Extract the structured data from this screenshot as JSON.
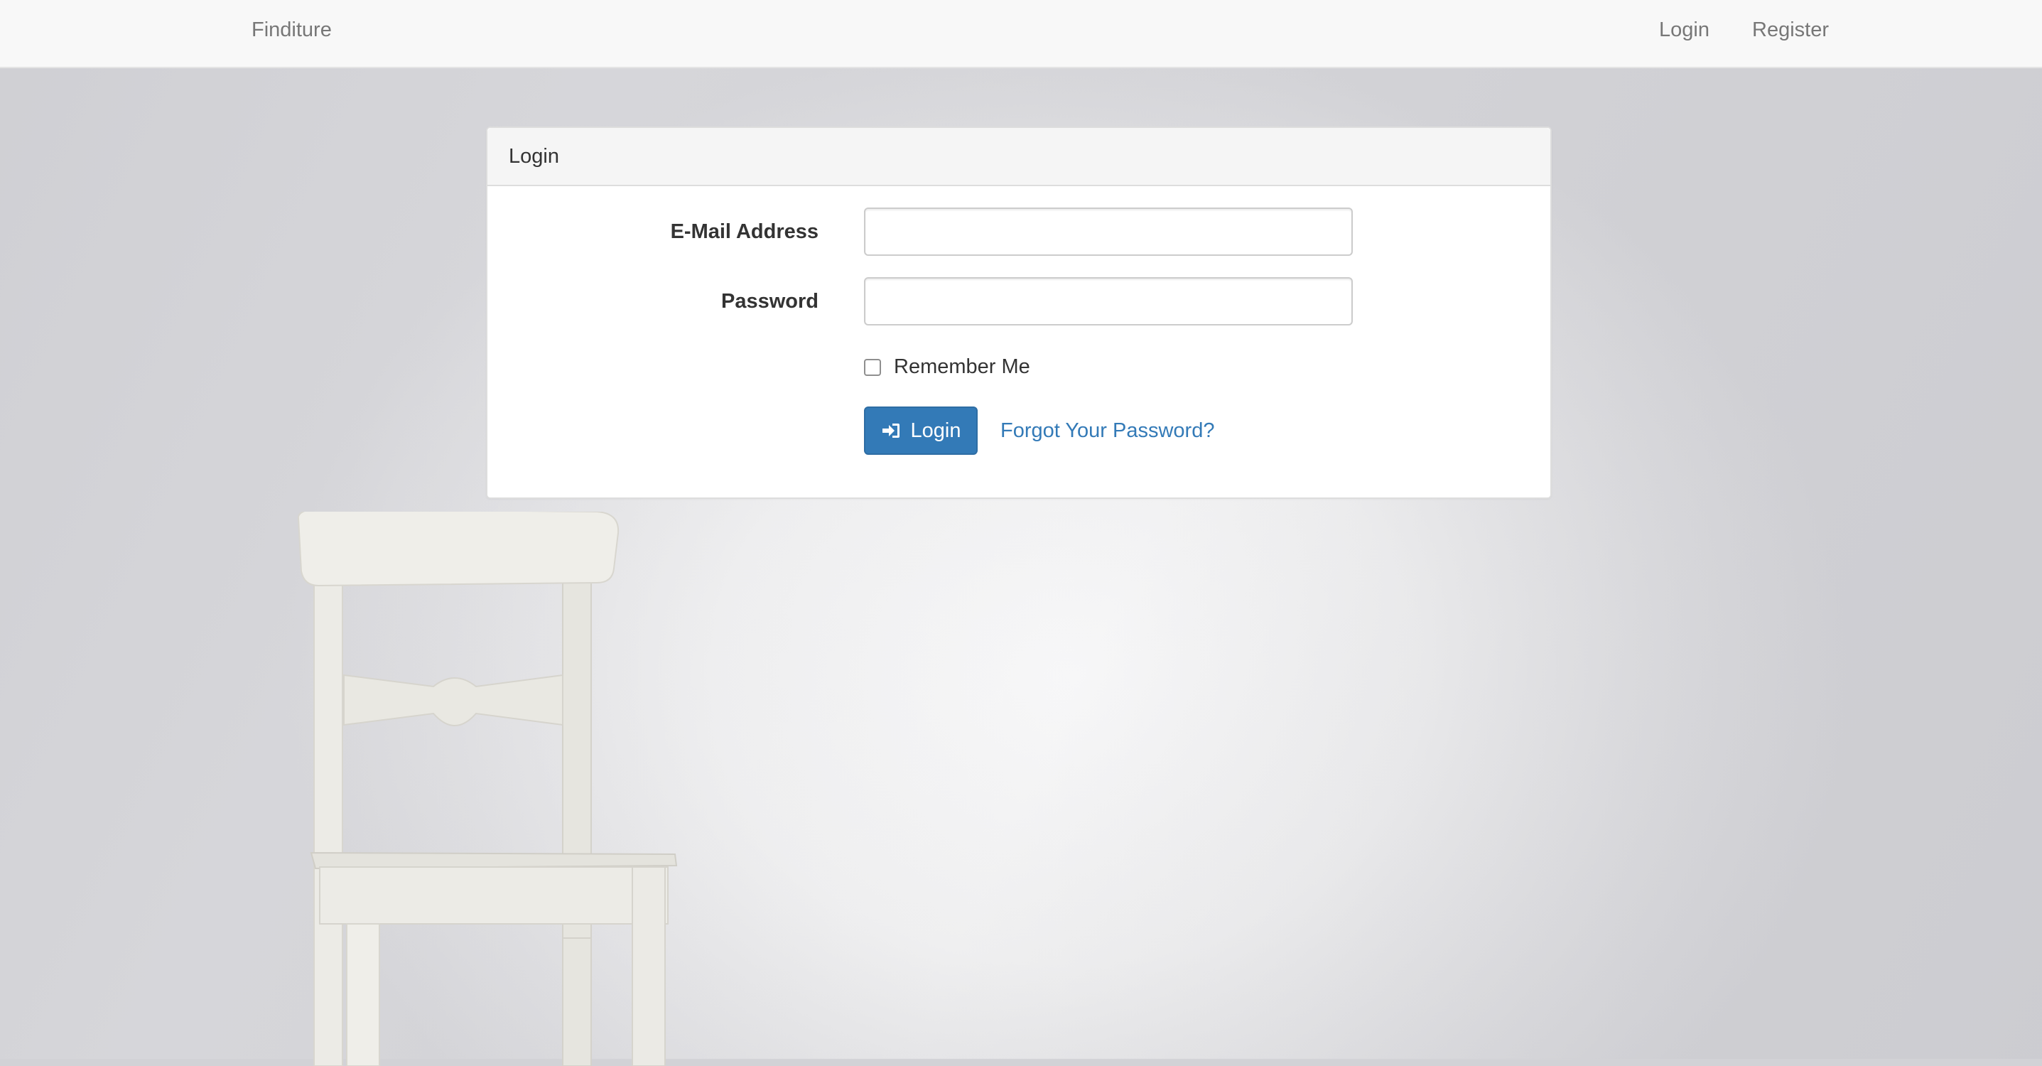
{
  "navbar": {
    "brand": "Finditure",
    "links": {
      "login": "Login",
      "register": "Register"
    }
  },
  "panel": {
    "title": "Login",
    "email": {
      "label": "E-Mail Address",
      "value": "",
      "placeholder": ""
    },
    "password": {
      "label": "Password",
      "value": "",
      "placeholder": ""
    },
    "remember": {
      "label": "Remember Me",
      "checked": false
    },
    "submit_label": "Login",
    "forgot_label": "Forgot Your Password?"
  },
  "icons": {
    "submit": "sign-in-icon"
  },
  "colors": {
    "primary": "#337ab7",
    "navbar_bg": "#f8f8f8",
    "nav_text": "#777777",
    "panel_heading_bg": "#f5f5f5"
  }
}
